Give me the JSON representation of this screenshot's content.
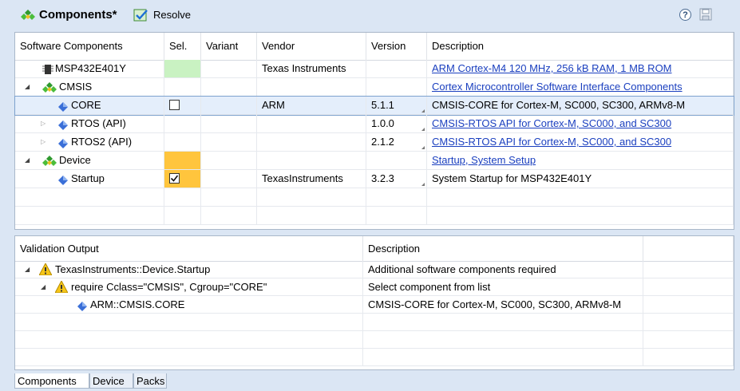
{
  "toolbar": {
    "title": "Components*",
    "resolve_label": "Resolve",
    "help_glyph": "?"
  },
  "components_table": {
    "headers": [
      "Software Components",
      "Sel.",
      "Variant",
      "Vendor",
      "Version",
      "Description"
    ],
    "rows": [
      {
        "name": "MSP432E401Y",
        "icon": "chip-icon",
        "sel": "green",
        "variant": "",
        "vendor": "Texas Instruments",
        "version": "",
        "description": "ARM Cortex-M4 120 MHz, 256 kB RAM, 1 MB ROM",
        "link": true
      },
      {
        "name": "CMSIS",
        "icon": "component-group-icon",
        "expander": "open",
        "sel": "",
        "variant": "",
        "vendor": "",
        "version": "",
        "description": "Cortex Microcontroller Software Interface Components",
        "link": true
      },
      {
        "name": "CORE",
        "icon": "component-icon",
        "sel": "unchecked",
        "variant": "",
        "vendor": "ARM",
        "version": "5.1.1",
        "description": "CMSIS-CORE for Cortex-M, SC000, SC300, ARMv8-M",
        "link": false,
        "selected": true
      },
      {
        "name": "RTOS (API)",
        "icon": "component-icon",
        "expander": "closed",
        "sel": "",
        "variant": "",
        "vendor": "",
        "version": "1.0.0",
        "description": "CMSIS-RTOS API for Cortex-M, SC000, and SC300",
        "link": true
      },
      {
        "name": "RTOS2 (API)",
        "icon": "component-icon",
        "expander": "closed",
        "sel": "",
        "variant": "",
        "vendor": "",
        "version": "2.1.2",
        "description": "CMSIS-RTOS API for Cortex-M, SC000, and SC300",
        "link": true
      },
      {
        "name": "Device",
        "icon": "component-group-icon",
        "expander": "open",
        "sel": "orange",
        "variant": "",
        "vendor": "",
        "version": "",
        "description": "Startup, System Setup",
        "link": true
      },
      {
        "name": "Startup",
        "icon": "component-icon",
        "sel": "checked-orange",
        "variant": "",
        "vendor": "TexasInstruments",
        "version": "3.2.3",
        "description": "System Startup for MSP432E401Y",
        "link": false
      }
    ]
  },
  "validation_table": {
    "headers": [
      "Validation Output",
      "Description"
    ],
    "rows": [
      {
        "text": "TexasInstruments::Device.Startup",
        "icon": "warning-icon",
        "description": "Additional software components required"
      },
      {
        "text": "require Cclass=\"CMSIS\", Cgroup=\"CORE\"",
        "icon": "warning-icon",
        "description": "Select component from list"
      },
      {
        "text": "ARM::CMSIS.CORE",
        "icon": "component-icon",
        "description": "CMSIS-CORE for Cortex-M, SC000, SC300, ARMv8-M"
      }
    ]
  },
  "tabs": [
    "Components",
    "Device",
    "Packs"
  ],
  "colors": {
    "link": "#1a3fbf",
    "sel_green": "#c9f2c2",
    "sel_orange": "#ffc53d",
    "selection_bg": "#e4eefb"
  }
}
